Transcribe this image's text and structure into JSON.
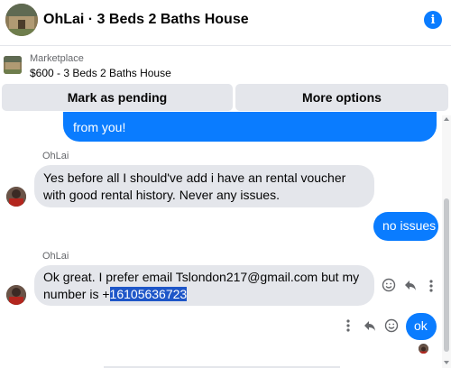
{
  "header": {
    "title": "OhLai · 3 Beds 2 Baths House",
    "info_icon": "info-icon"
  },
  "marketplace": {
    "label": "Marketplace",
    "listing": "$600 - 3 Beds 2 Baths House"
  },
  "actions": {
    "mark_pending": "Mark as pending",
    "more_options": "More options"
  },
  "messages": {
    "m1": "from you!",
    "sender1": "OhLai",
    "m2": "Yes before all I should've add i have an rental voucher with good rental history. Never any issues.",
    "m3": "no issues",
    "sender2": "OhLai",
    "m4_text": "Ok great. I prefer email Tslondon217@gmail.com but my number is +",
    "m4_highlight": "16105636723",
    "m5": "ok"
  },
  "colors": {
    "accent": "#0a7cff",
    "incoming_bubble": "#e4e6eb",
    "selection": "#1e56c8"
  }
}
